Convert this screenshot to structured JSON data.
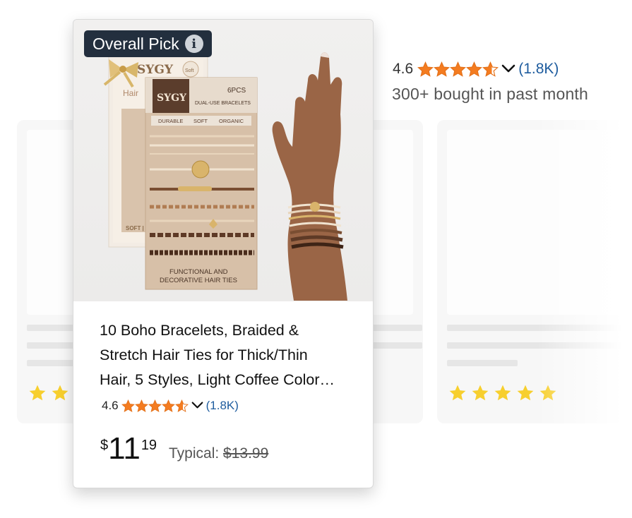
{
  "main_product": {
    "badge_label": "Overall Pick",
    "title_lines": [
      "10 Boho Bracelets, Braided &",
      "Stretch Hair Ties for Thick/Thin",
      "Hair, 5 Styles, Light Coffee Color…"
    ],
    "rating": "4.6",
    "stars_value": 4.6,
    "review_count": "(1.8K)",
    "price_symbol": "$",
    "price_whole": "11",
    "price_fraction": "19",
    "typical_label": "Typical:",
    "typical_price": "$13.99",
    "package": {
      "brand": "SYGY",
      "count": "6PCS",
      "subtitle": "DUAL-USE BRACELETS",
      "tags": [
        "DURABLE",
        "SOFT",
        "ORGANIC"
      ],
      "footer_line1": "FUNCTIONAL AND",
      "footer_line2": "DECORATIVE HAIR TIES",
      "back_brand": "SYGY",
      "back_label": "Hair",
      "back_footer": "SOFT | D",
      "seal_text": "Soft"
    }
  },
  "top_right": {
    "rating": "4.6",
    "stars_value": 4.6,
    "review_count": "(1.8K)",
    "bought_text": "300+ bought in past month"
  },
  "colors": {
    "star": "#f47c20",
    "link": "#1e5c9e",
    "badge_bg": "#232f3e",
    "placeholder_star": "#f7cf2e"
  }
}
